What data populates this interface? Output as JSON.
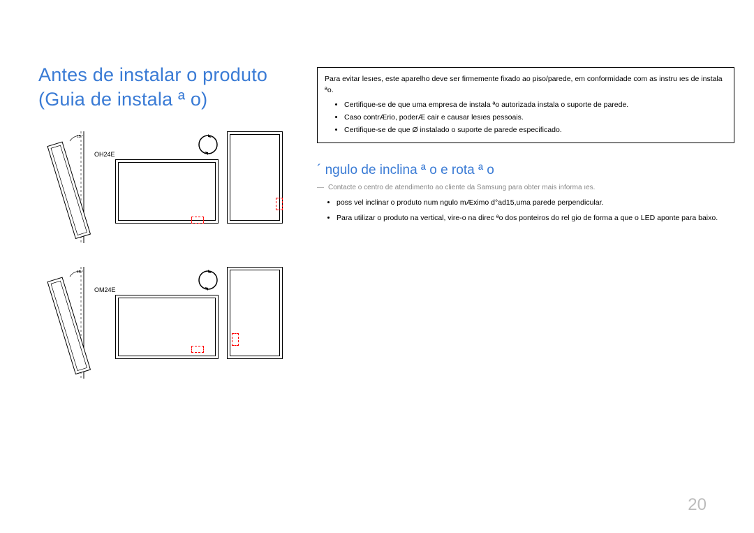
{
  "title": "Antes de instalar o produto (Guia de instala ª o)",
  "diagrams": {
    "row1": {
      "model": "OH24E",
      "angle": "15 °"
    },
    "row2": {
      "model": "OM24E",
      "angle": "15 °"
    }
  },
  "warning": {
    "intro": "Para evitar lesıes, este aparelho deve ser firmemente fixado ao piso/parede, em conformidade com as instru ıes de instala ªo.",
    "items": [
      "Certifique-se de que uma empresa de instala ªo autorizada instala o suporte de parede.",
      "Caso contrÆrio, poderÆ cair e causar lesıes pessoais.",
      "Certifique-se de que Ø instalado o suporte de parede especificado."
    ]
  },
  "section": {
    "heading": "´ ngulo de inclina ª o e rota ª o",
    "note": "Contacte o centro de atendimento ao cliente da Samsung para obter mais informa ıes.",
    "bullets": [
      " poss vel inclinar o produto num  ngulo mÆximo d°ad15,uma parede perpendicular.",
      "Para utilizar o produto na vertical, vire-o na direc ªo dos ponteiros do rel gio de forma a que o LED aponte para baixo."
    ]
  },
  "pageNumber": "20"
}
